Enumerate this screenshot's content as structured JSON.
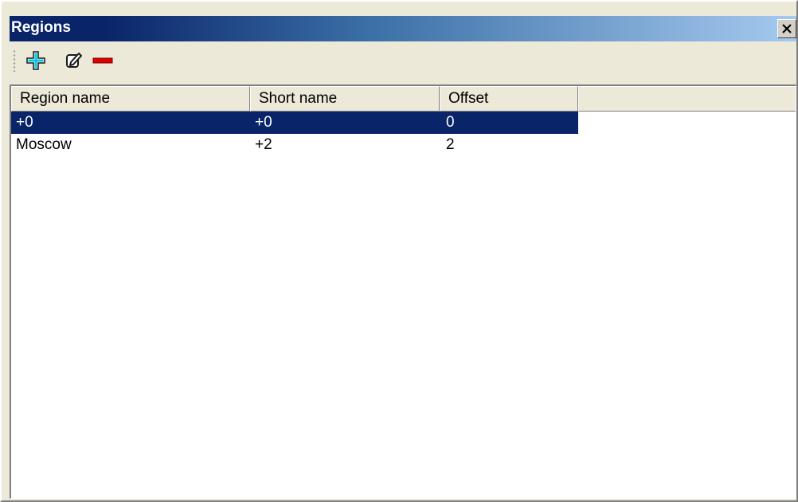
{
  "window": {
    "title": "Regions"
  },
  "toolbar": {
    "buttons": [
      {
        "name": "add",
        "icon": "plus-icon"
      },
      {
        "name": "edit",
        "icon": "edit-icon"
      },
      {
        "name": "remove",
        "icon": "minus-icon"
      }
    ]
  },
  "table": {
    "columns": [
      "Region name",
      "Short name",
      "Offset"
    ],
    "rows": [
      {
        "region_name": "+0",
        "short_name": "+0",
        "offset": "0",
        "selected": true
      },
      {
        "region_name": "Moscow",
        "short_name": "+2",
        "offset": "2",
        "selected": false
      }
    ]
  },
  "colors": {
    "selection": "#0a246a",
    "title_start": "#0a246a",
    "title_end": "#a6caf0",
    "add_icon": "#00c0e0",
    "remove_icon": "#e00000"
  }
}
